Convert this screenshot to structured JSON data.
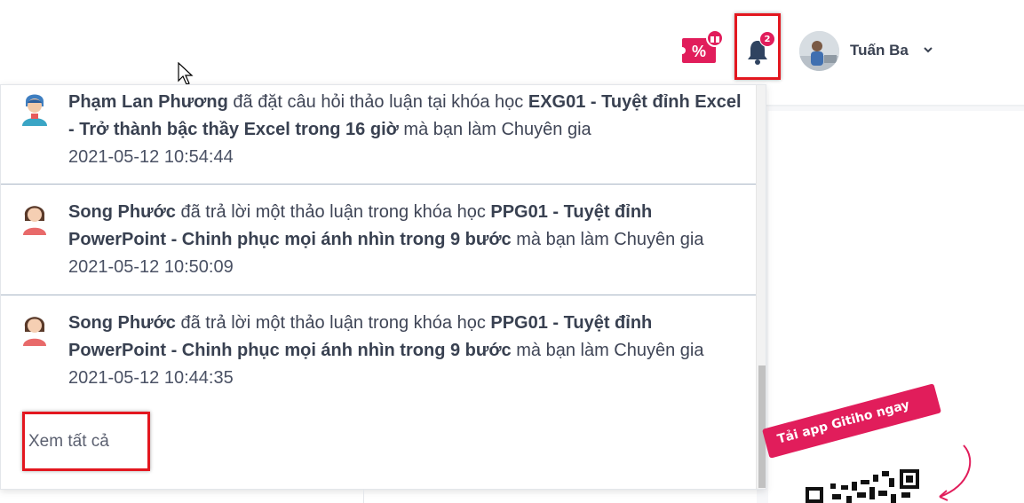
{
  "header": {
    "user_name": "Tuấn Ba",
    "notification_count": "2",
    "icons": [
      "promo-gift-icon",
      "bell-icon",
      "chevron-down-icon"
    ]
  },
  "notifications": {
    "items": [
      {
        "actor": "Phạm Lan Phương",
        "action": " đã đặt câu hỏi thảo luận tại khóa học ",
        "course": "EXG01 - Tuyệt đỉnh Excel - Trở thành bậc thầy Excel trong 16 giờ",
        "suffix": " mà bạn làm Chuyên gia",
        "time": "2021-05-12 10:54:44"
      },
      {
        "actor": "Song Phước",
        "action": " đã trả lời một thảo luận trong khóa học ",
        "course": "PPG01 - Tuyệt đỉnh PowerPoint - Chinh phục mọi ánh nhìn trong 9 bước",
        "suffix": " mà bạn làm Chuyên gia",
        "time": "2021-05-12 10:50:09"
      },
      {
        "actor": "Song Phước",
        "action": " đã trả lời một thảo luận trong khóa học ",
        "course": "PPG01 - Tuyệt đỉnh PowerPoint - Chinh phục mọi ánh nhìn trong 9 bước",
        "suffix": " mà bạn làm Chuyên gia",
        "time": "2021-05-12 10:44:35"
      }
    ],
    "see_all_label": "Xem tất cả"
  },
  "promo": {
    "app_tag": "Tải app Gitiho ngay"
  },
  "colors": {
    "accent": "#e11d5b",
    "highlight_border": "#e3171f",
    "text": "#3f4556"
  }
}
